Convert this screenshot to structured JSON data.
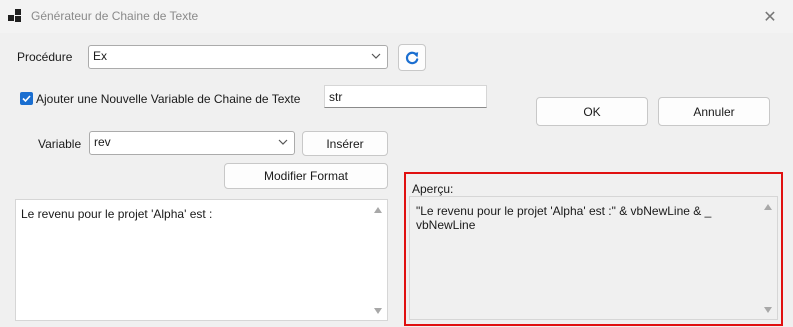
{
  "window": {
    "title": "Générateur de Chaine de Texte",
    "close_glyph": "✕"
  },
  "procedure": {
    "label": "Procédure",
    "value": "Ex"
  },
  "new_variable": {
    "checkbox_label": "Ajouter une Nouvelle Variable de Chaine de Texte",
    "checked": true,
    "name_value": "str"
  },
  "variable": {
    "label": "Variable",
    "value": "rev",
    "insert_label": "Insérer"
  },
  "modify_format_label": "Modifier Format",
  "dialog_buttons": {
    "ok_label": "OK",
    "cancel_label": "Annuler"
  },
  "input_text": "Le revenu pour le projet 'Alpha' est :",
  "preview": {
    "label": "Aperçu:",
    "text_line1": "\"Le revenu pour le projet 'Alpha' est :\" & vbNewLine & _",
    "text_line2": "vbNewLine"
  },
  "colors": {
    "accent": "#1a6ed0",
    "highlight_border": "#e01010"
  }
}
